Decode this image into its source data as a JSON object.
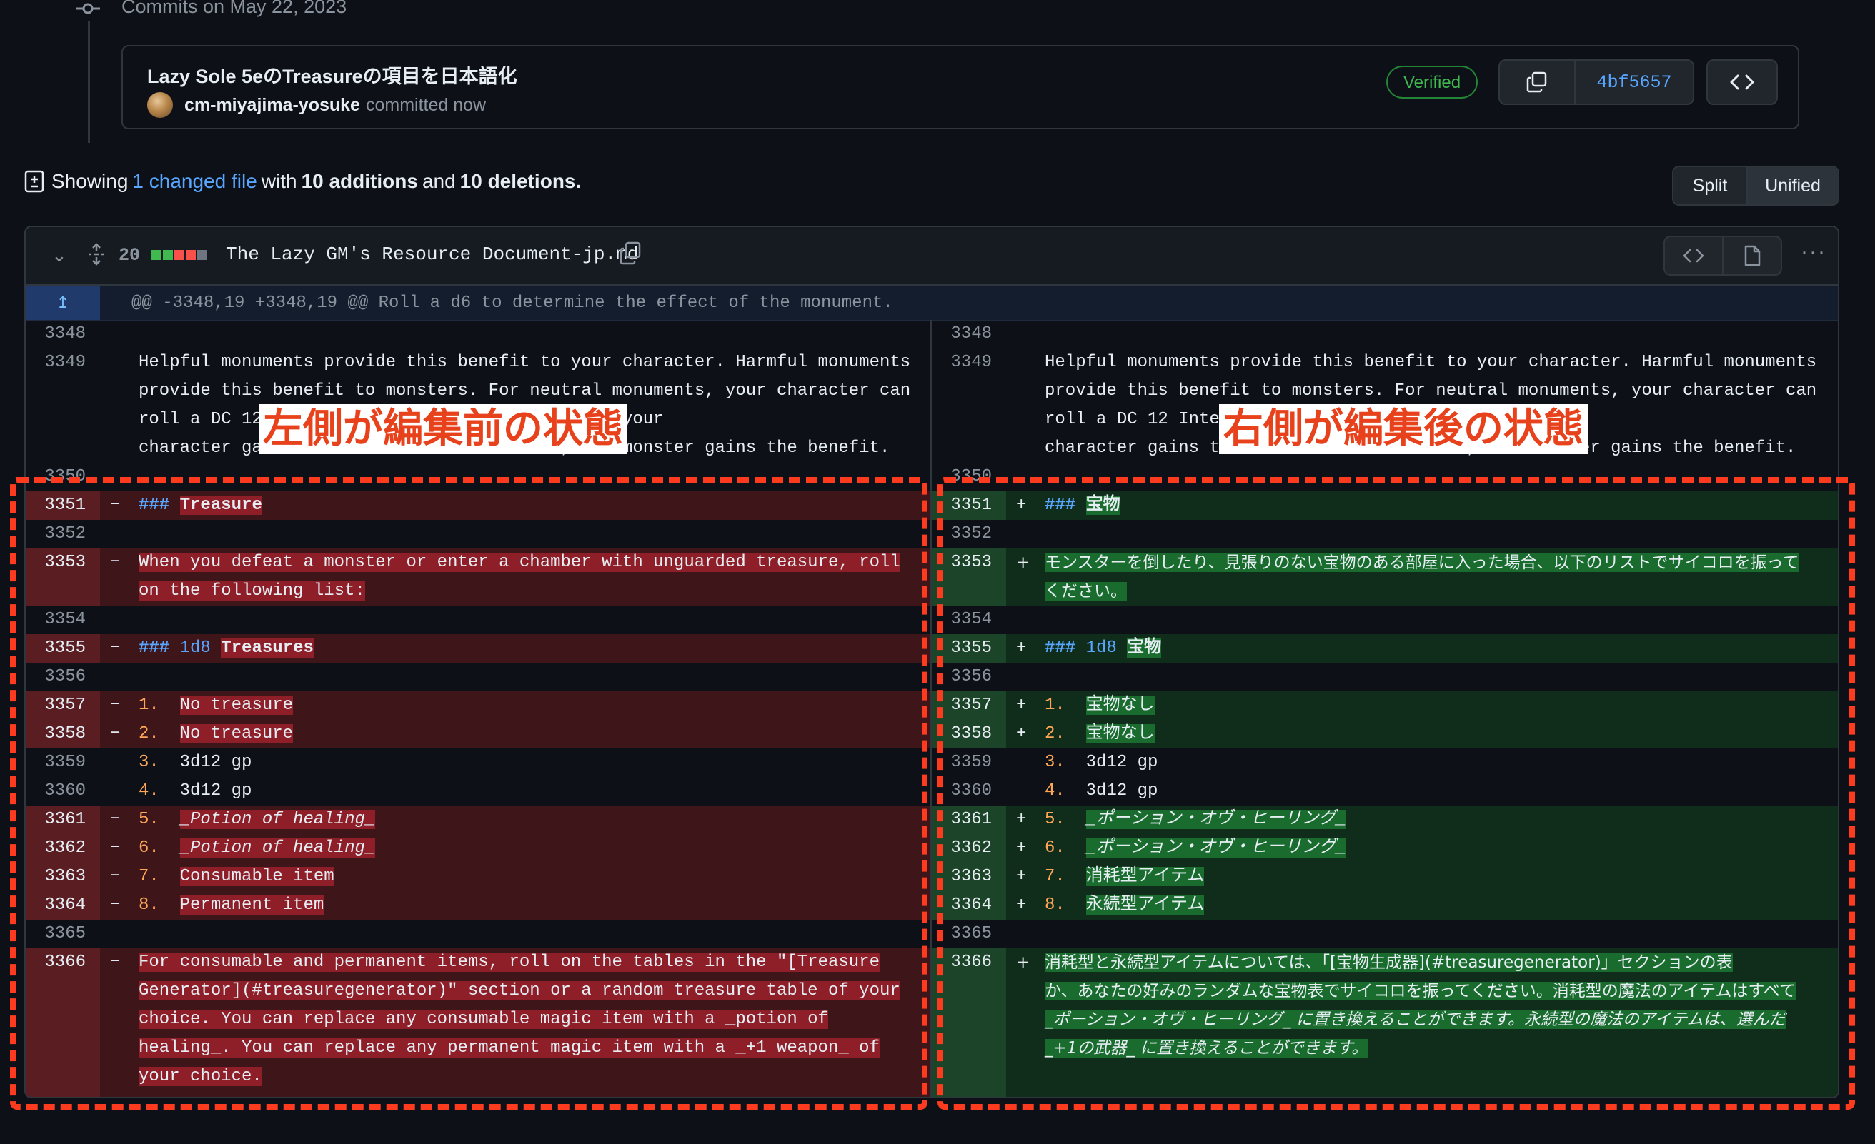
{
  "timeline": {
    "date_label": "Commits on May 22, 2023"
  },
  "commit": {
    "title": "Lazy Sole 5eのTreasureの項目を日本語化",
    "author": "cm-miyajima-yosuke",
    "when": "committed now",
    "verified": "Verified",
    "sha": "4bf5657",
    "browse_label": "<>"
  },
  "summary": {
    "prefix": "Showing",
    "changed_files": "1 changed file",
    "with": "with",
    "additions": "10 additions",
    "and": "and",
    "deletions": "10 deletions."
  },
  "view_toggle": {
    "split": "Split",
    "unified": "Unified"
  },
  "file": {
    "change_count": "20",
    "name": "The Lazy GM's Resource Document-jp.md",
    "diffstat_colors": [
      "#3fb950",
      "#3fb950",
      "#f85149",
      "#f85149",
      "#6e7681"
    ]
  },
  "hunk": {
    "header": "@@ -3348,19 +3348,19 @@ Roll a d6 to determine the effect of the monument."
  },
  "annotations": {
    "left_label": "左側が編集前の状態",
    "right_label": "右側が編集後の状態",
    "box_color": "#ff3b1f"
  },
  "left": {
    "context": {
      "l3348": "3348",
      "l3349": "3349",
      "t3349a": "Helpful monuments provide this benefit to your character. Harmful monuments",
      "t3349b": "provide this benefit to monsters. For neutral monuments, your character can",
      "t3349c": "roll a DC 12 Intelligence check. On a success, your",
      "t3349d": "character gains the benefit. On a failure, the monster gains the benefit.",
      "l3350": "3350",
      "l3352": "3352",
      "l3354": "3354",
      "l3356": "3356",
      "l3359": "3359",
      "l3360": "3360",
      "l3365": "3365"
    },
    "l3351": "3351",
    "t3351_hdr": "###",
    "t3351": "Treasure",
    "l3353": "3353",
    "t3353a": "When you defeat a monster or enter a chamber with unguarded treasure, roll",
    "t3353b": "on the following list:",
    "l3355": "3355",
    "t3355_hdr": "###",
    "t3355_die": "1d8",
    "t3355": "Treasures",
    "l3357": "3357",
    "n3357": "1.",
    "t3357": "No treasure",
    "l3358": "3358",
    "n3358": "2.",
    "t3358": "No treasure",
    "n3359": "3.",
    "t3359": "3d12 gp",
    "n3360": "4.",
    "t3360": "3d12 gp",
    "l3361": "3361",
    "n3361": "5.",
    "t3361": "_Potion of healing_",
    "l3362": "3362",
    "n3362": "6.",
    "t3362": "_Potion of healing_",
    "l3363": "3363",
    "n3363": "7.",
    "t3363": "Consumable item",
    "l3364": "3364",
    "n3364": "8.",
    "t3364": "Permanent item",
    "l3366": "3366",
    "t3366a": "For consumable and permanent items, roll on the tables in the \"[Treasure",
    "t3366b": "Generator](#treasuregenerator)\" section or a random treasure table of your",
    "t3366c": "choice. You can replace any consumable magic item with a _potion of",
    "t3366d": "healing_. You can replace any permanent magic item with a _+1 weapon_ of",
    "t3366e": "your choice."
  },
  "right": {
    "context": {
      "l3348": "3348",
      "l3349": "3349",
      "t3349a": "Helpful monuments provide this benefit to your character. Harmful monuments",
      "t3349b": "provide this benefit to monsters. For neutral monuments, your character can",
      "t3349c": "roll a DC 12 Intelligence check. On a success, your",
      "t3349d": "character gains the benefit. On a failure, the monster gains the benefit.",
      "l3350": "3350",
      "l3352": "3352",
      "l3354": "3354",
      "l3356": "3356",
      "l3359": "3359",
      "l3360": "3360",
      "l3365": "3365"
    },
    "l3351": "3351",
    "t3351_hdr": "###",
    "t3351": "宝物",
    "l3353": "3353",
    "t3353a": "モンスターを倒したり、見張りのない宝物のある部屋に入った場合、以下のリストでサイコロを振って",
    "t3353b": "ください。",
    "l3355": "3355",
    "t3355_hdr": "###",
    "t3355_die": "1d8",
    "t3355": "宝物",
    "l3357": "3357",
    "n3357": "1.",
    "t3357": "宝物なし",
    "l3358": "3358",
    "n3358": "2.",
    "t3358": "宝物なし",
    "n3359": "3.",
    "t3359": "3d12 gp",
    "n3360": "4.",
    "t3360": "3d12 gp",
    "l3361": "3361",
    "n3361": "5.",
    "t3361": "_ポーション・オヴ・ヒーリング_",
    "l3362": "3362",
    "n3362": "6.",
    "t3362": "_ポーション・オヴ・ヒーリング_",
    "l3363": "3363",
    "n3363": "7.",
    "t3363": "消耗型アイテム",
    "l3364": "3364",
    "n3364": "8.",
    "t3364": "永続型アイテム",
    "l3366": "3366",
    "t3366a": "消耗型と永続型アイテムについては、「[宝物生成器](#treasuregenerator)」セクションの表",
    "t3366b": "か、あなたの好みのランダムな宝物表でサイコロを振ってください。消耗型の魔法のアイテムはすべて",
    "t3366c": "_ポーション・オヴ・ヒーリング_ に置き換えることができます。永続型の魔法のアイテムは、選んだ",
    "t3366d": "_+1の武器_ に置き換えることができます。"
  }
}
